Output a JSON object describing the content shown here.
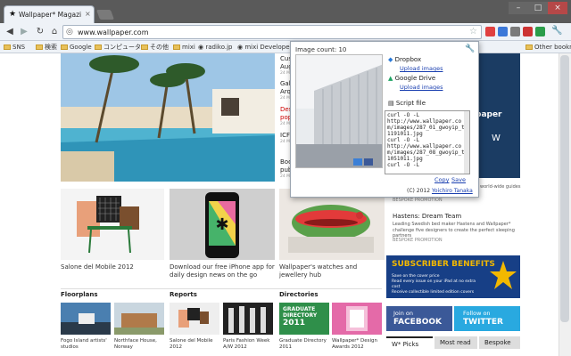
{
  "browser": {
    "tab_title": "Wallpaper* Magazine: de",
    "tab_close": "×",
    "url": "www.wallpaper.com",
    "window_controls": [
      "–",
      "□",
      "×"
    ]
  },
  "bookmarks": [
    "SNS",
    "検索",
    "Google",
    "コンピュータ",
    "その他",
    "mixi",
    "radiko.jp",
    "mixi Developer C"
  ],
  "bookmarks_other": "Other bookmarks",
  "popup": {
    "image_count": "Image count: 10",
    "dropbox_label": "Dropbox",
    "dropbox_upload": "Upload images",
    "gdrive_label": "Google Drive",
    "gdrive_upload": "Upload images",
    "script_label": "Script file",
    "script_text": "curl -O -L\nhttp://www.wallpaper.com/images/287_01_gwoyip_t1191011.jpg\ncurl -O -L\nhttp://www.wallpaper.com/images/287_08_gwoyip_t1051011.jpg\ncurl -O -L",
    "copy": "Copy",
    "save": "Save",
    "footer_prefix": "(C) 2012",
    "footer_author": "Yoichiro Tanaka"
  },
  "side_stories": [
    {
      "text": "Cust",
      "red": false
    },
    {
      "text": "Augu",
      "red": false
    },
    {
      "text": "Gale",
      "red": false
    },
    {
      "text": "Arqu",
      "red": false
    },
    {
      "text": "Desi",
      "red": true
    },
    {
      "text": "pop-",
      "red": true
    },
    {
      "text": "ICFF",
      "red": false
    },
    {
      "text": "Boor",
      "red": false
    },
    {
      "text": "publi",
      "red": false
    }
  ],
  "side_dates": [
    "24 MAY",
    "24 MAY",
    "24 MAY",
    "24 MAY",
    "24 MAY"
  ],
  "grid": [
    {
      "caption": "Salone del Mobile 2012"
    },
    {
      "caption": "Download our free iPhone app for daily design news on the go"
    },
    {
      "caption": "Wallpaper's watches and jewellery hub"
    }
  ],
  "sections": {
    "floorplans": "Floorplans",
    "reports": "Reports",
    "directories": "Directories"
  },
  "thumbs": [
    {
      "caption": "Fogo Island artists' studios"
    },
    {
      "caption": "Northface House, Norway"
    },
    {
      "caption": "Salone del Mobile 2012"
    },
    {
      "caption": "Paris Fashion Week A/W 2012"
    },
    {
      "caption": "Graduate Directory 2011"
    },
    {
      "caption": "Wallpaper* Design Awards 2012"
    }
  ],
  "graduate_thumb_text": [
    "GRADUATE",
    "DIRECTORY",
    "2011"
  ],
  "right_column": {
    "ad_text": "paper",
    "ad_small": "W",
    "worldwide": "world-wide guides",
    "promo1_tag": "BESPOKE PROMOTION",
    "promo2_title": "Hastens: Dream Team",
    "promo2_body": "Leading Swedish bed maker Hastens and Wallpaper* challenge five designers to create the perfect sleeping partners",
    "promo2_tag": "BESPOKE PROMOTION",
    "subscriber_title": "SUBSCRIBER BENEFITS",
    "subscriber_lines": [
      "Save on the cover price",
      "Read every issue on your iPad at no extra cost",
      "Receive collectible limited edition covers"
    ],
    "facebook": [
      "Join on",
      "FACEBOOK"
    ],
    "twitter": [
      "Follow on",
      "TWITTER"
    ],
    "tabs": [
      "W* Picks",
      "Most read",
      "Bespoke"
    ]
  },
  "colors": {
    "titlebar": "#5a5a5a",
    "facebook": "#3b5998",
    "twitter": "#29a9e0",
    "subscriber": "#173f86",
    "link": "#1a3fb0"
  }
}
